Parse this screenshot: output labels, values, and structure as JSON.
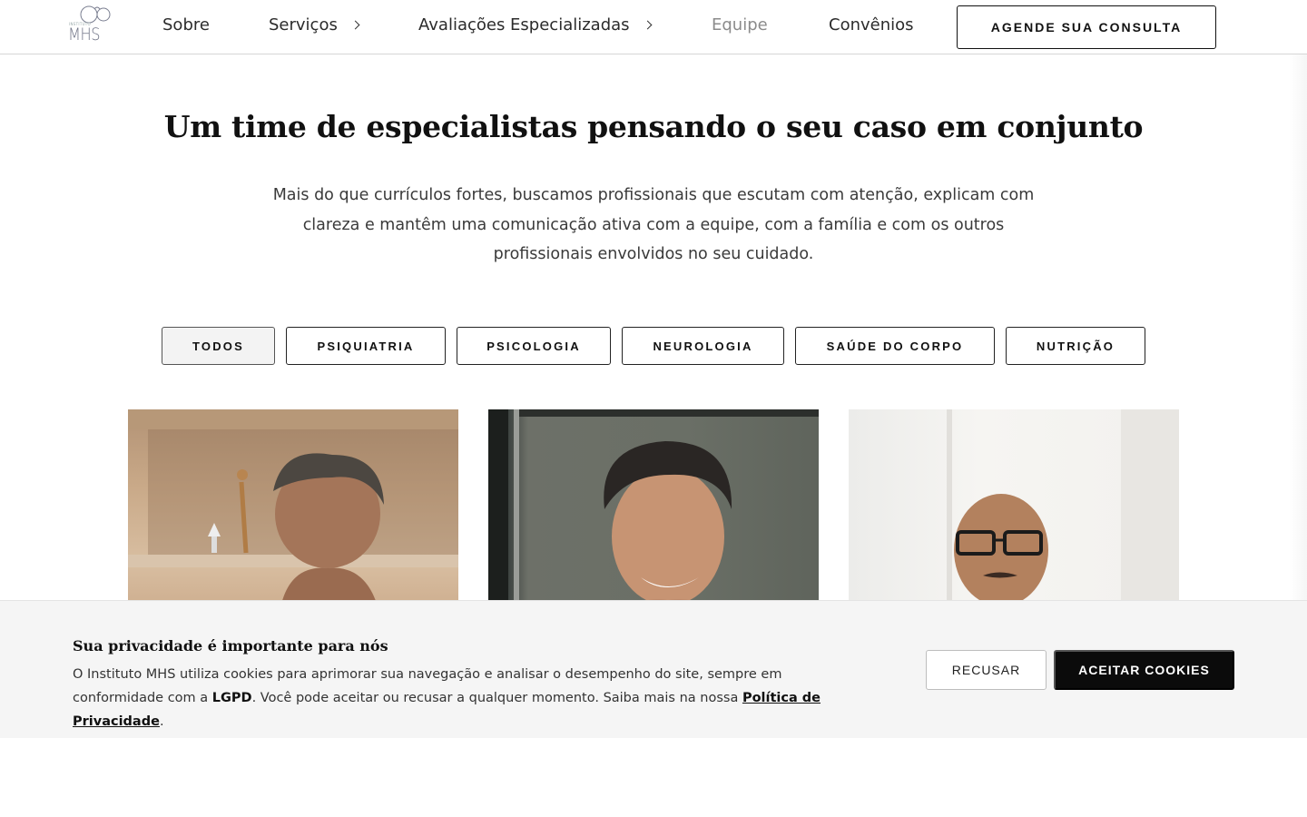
{
  "header": {
    "logo_tag": "INSTITUTO",
    "logo_text": "MHS",
    "nav": [
      {
        "label": "Sobre",
        "has_submenu": false,
        "active": false
      },
      {
        "label": "Serviços",
        "has_submenu": true,
        "active": false
      },
      {
        "label": "Avaliações Especializadas",
        "has_submenu": true,
        "active": false
      },
      {
        "label": "Equipe",
        "has_submenu": false,
        "active": true
      },
      {
        "label": "Convênios",
        "has_submenu": false,
        "active": false
      }
    ],
    "cta_label": "AGENDE SUA CONSULTA"
  },
  "main": {
    "title": "Um time de especialistas pensando o seu caso em conjunto",
    "intro": "Mais do que currículos fortes, buscamos profissionais que escutam com atenção, explicam com clareza e mantêm uma comunicação ativa com a equipe, com a família e com os outros profissionais envolvidos no seu cuidado.",
    "filters": [
      {
        "label": "TODOS",
        "selected": true
      },
      {
        "label": "PSIQUIATRIA",
        "selected": false
      },
      {
        "label": "PSICOLOGIA",
        "selected": false
      },
      {
        "label": "NEUROLOGIA",
        "selected": false
      },
      {
        "label": "SAÚDE DO CORPO",
        "selected": false
      },
      {
        "label": "NUTRIÇÃO",
        "selected": false
      }
    ]
  },
  "cookie_banner": {
    "title": "Sua privacidade é importante para nós",
    "text_part1": "O Instituto MHS utiliza cookies para aprimorar sua navegação e analisar o desempenho do site, sempre em conformidade com a ",
    "text_bold": "LGPD",
    "text_part2": ". Você pode aceitar ou recusar a qualquer momento. Saiba mais na nossa ",
    "link_label": "Política de Privacidade",
    "text_end": ".",
    "refuse_label": "RECUSAR",
    "accept_label": "ACEITAR COOKIES"
  },
  "colors": {
    "primary": "#0b0b0b",
    "banner_bg": "#f5f5f5",
    "nav_muted": "#8b8b8b",
    "logo": "#6e7285"
  }
}
